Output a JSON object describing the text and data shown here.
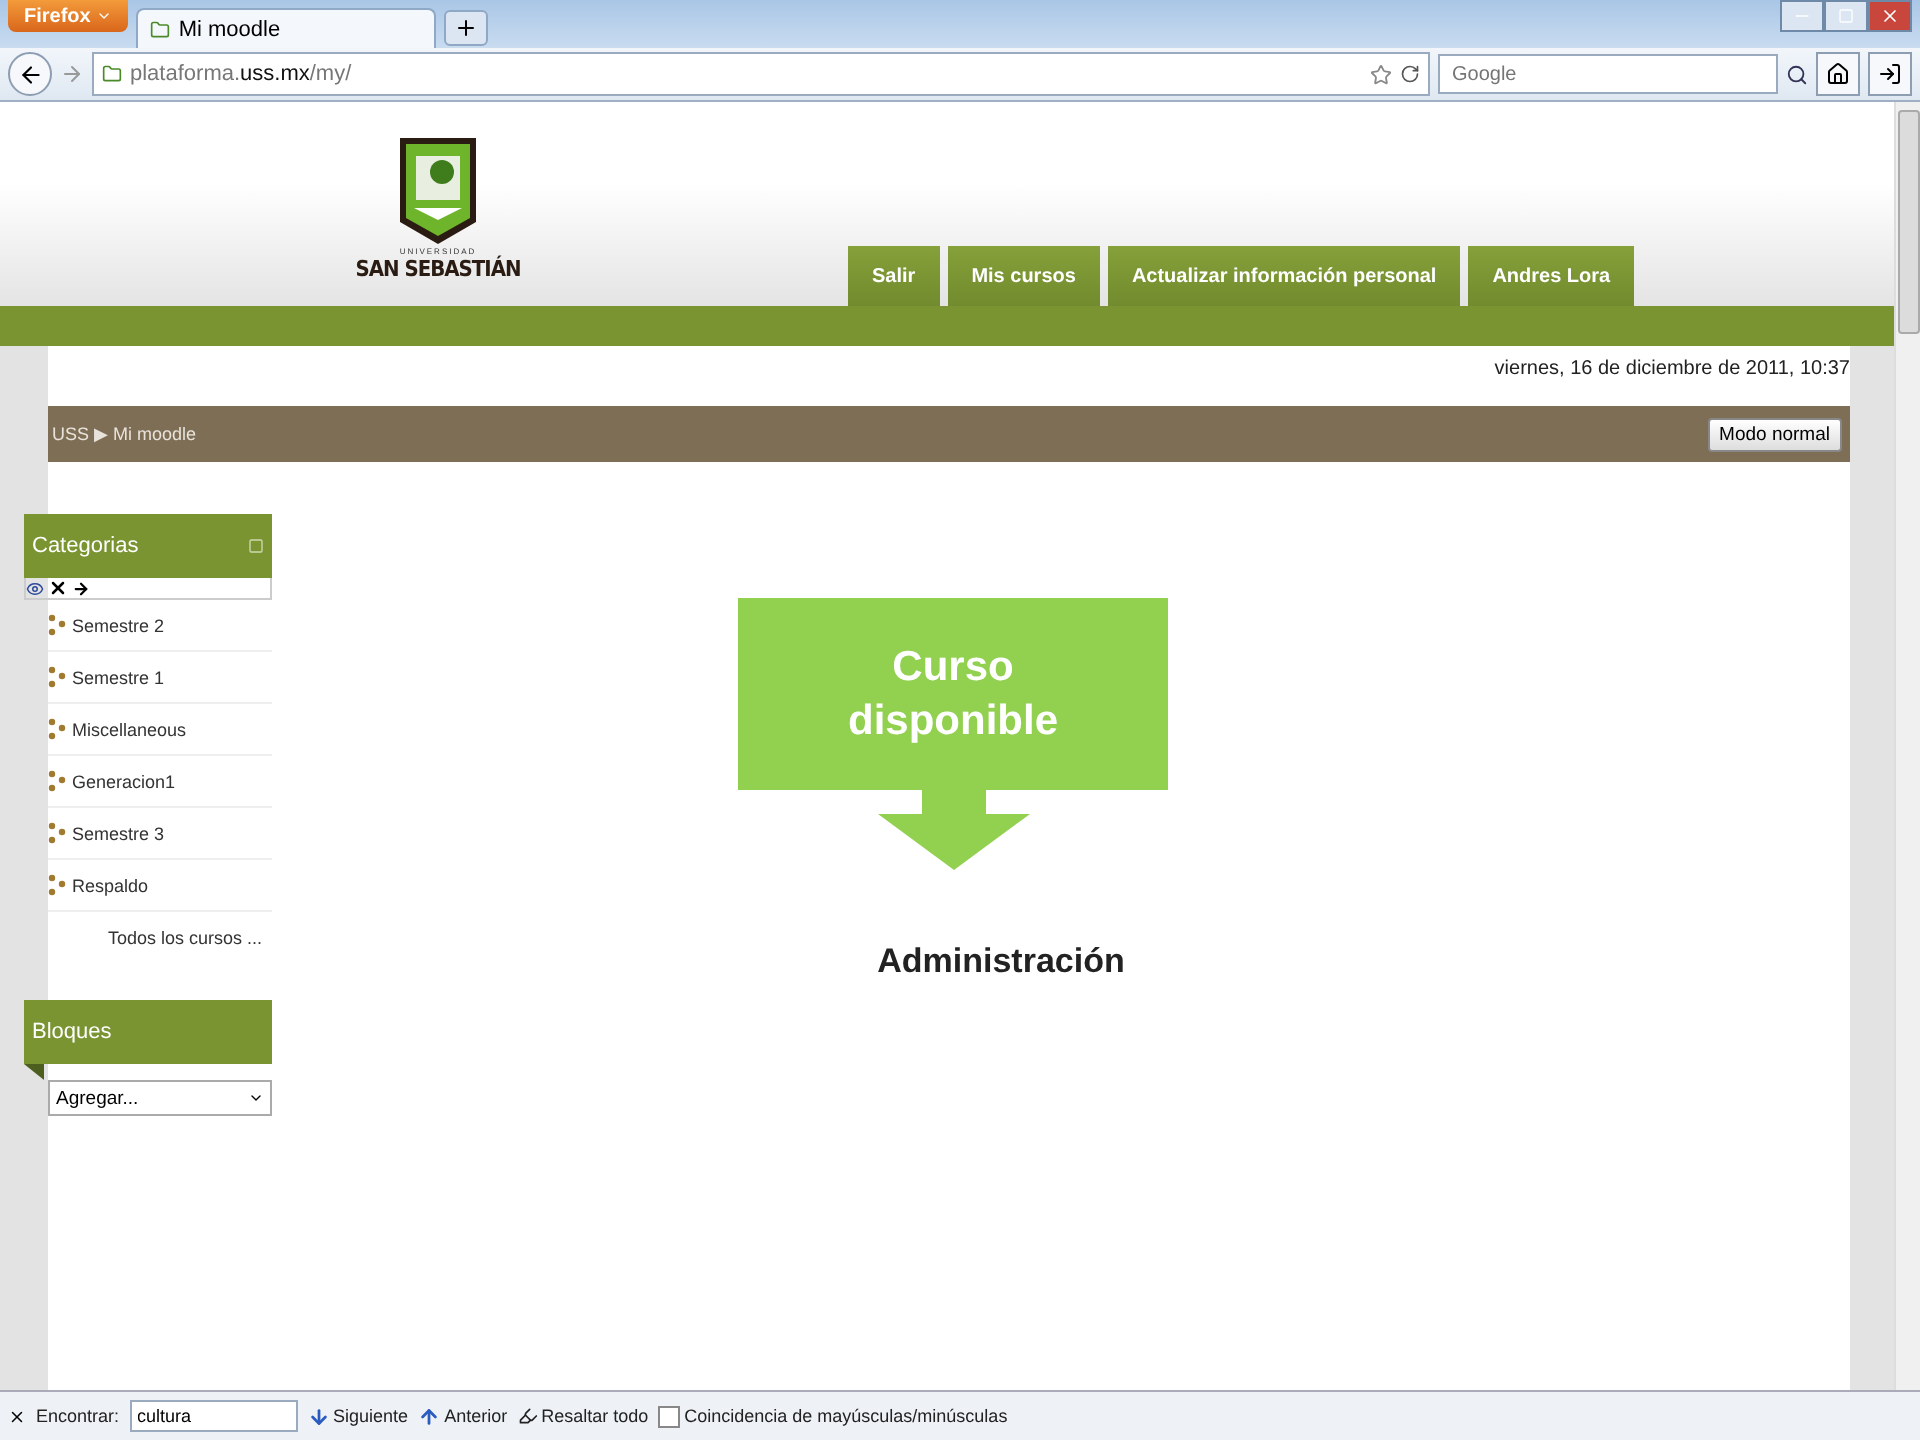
{
  "browser": {
    "menu_button": "Firefox",
    "tabs": [
      {
        "label": "Mi moodle",
        "selected": true
      }
    ],
    "address": {
      "prefix": "plataforma.",
      "domain": "uss.mx",
      "path": "/my/"
    },
    "search": {
      "placeholder": "Google"
    }
  },
  "header": {
    "logo_small": "UNIVERSIDAD",
    "logo_name": "SAN SEBASTIÁN",
    "nav": [
      {
        "label": "Salir"
      },
      {
        "label": "Mis cursos"
      },
      {
        "label": "Actualizar información personal"
      },
      {
        "label": "Andres Lora"
      }
    ]
  },
  "date": "viernes, 16 de diciembre de 2011, 10:37",
  "breadcrumb": {
    "root": "USS",
    "separator": "▶",
    "current": "Mi moodle",
    "button": "Modo normal"
  },
  "categories": {
    "title": "Categorias",
    "items": [
      {
        "label": "Semestre 2"
      },
      {
        "label": "Semestre 1"
      },
      {
        "label": "Miscellaneous"
      },
      {
        "label": "Generacion1"
      },
      {
        "label": "Semestre 3"
      },
      {
        "label": "Respaldo"
      }
    ],
    "all_link": "Todos los cursos ..."
  },
  "blocks": {
    "title": "Bloques",
    "select": "Agregar..."
  },
  "callout": {
    "text": "Curso disponible"
  },
  "main_heading": "Administración",
  "find_bar": {
    "label": "Encontrar:",
    "value": "cultura",
    "next": "Siguiente",
    "previous": "Anterior",
    "highlight": "Resaltar todo",
    "match_case": {
      "label": "Coincidencia de mayúsculas/minúsculas",
      "checked": false
    }
  }
}
